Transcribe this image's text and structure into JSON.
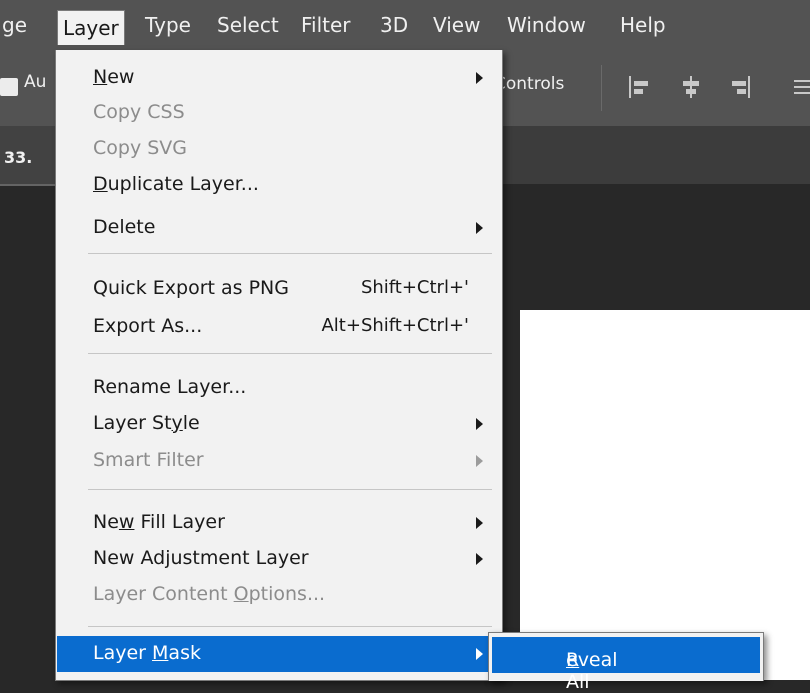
{
  "menubar": {
    "items": [
      "ge",
      "Layer",
      "Type",
      "Select",
      "Filter",
      "3D",
      "View",
      "Window",
      "Help"
    ],
    "active": "Layer"
  },
  "options_bar": {
    "auto_label": "Au",
    "controls_label": "Controls",
    "align_icons": [
      "align-left-edges-icon",
      "align-horizontal-centers-icon",
      "align-right-edges-icon",
      "align-top-edges-icon"
    ]
  },
  "tabbar": {
    "doc_tab_label": "33."
  },
  "layer_menu": {
    "new": {
      "pre": "",
      "u": "N",
      "post": "ew"
    },
    "copy_css": "Copy CSS",
    "copy_svg": "Copy SVG",
    "duplicate": {
      "pre": "",
      "u": "D",
      "post": "uplicate Layer..."
    },
    "delete": "Delete",
    "quick_export": "Quick Export as PNG",
    "quick_export_shortcut": "Shift+Ctrl+'",
    "export_as": "Export As...",
    "export_as_shortcut": "Alt+Shift+Ctrl+'",
    "rename": "Rename Layer...",
    "layer_style": {
      "pre": "Layer St",
      "u": "y",
      "post": "le"
    },
    "smart_filter": "Smart Filter",
    "new_fill": {
      "pre": "Ne",
      "u": "w",
      "post": " Fill Layer"
    },
    "new_adjustment": "New Adjustment Layer",
    "content_options": {
      "pre": "Layer Content ",
      "u": "O",
      "post": "ptions..."
    },
    "layer_mask": {
      "pre": "Layer ",
      "u": "M",
      "post": "ask"
    }
  },
  "submenu": {
    "reveal_all": {
      "pre": "",
      "u": "R",
      "post": "eveal All"
    }
  },
  "colors": {
    "menubar_bg": "#535353",
    "menu_bg": "#f2f2f2",
    "highlight": "#0a6ccf",
    "workspace": "#282828",
    "disabled_text": "#8c8c8c"
  }
}
